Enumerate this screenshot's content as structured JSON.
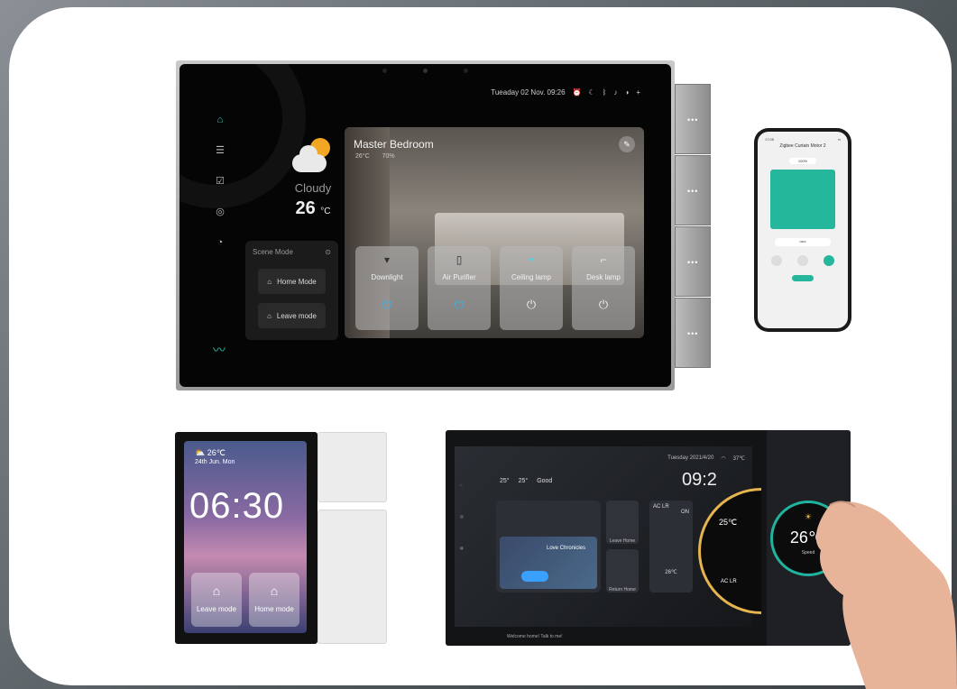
{
  "big_panel": {
    "datetime": "Tueaday 02 Nov. 09:26",
    "weather_condition": "Cloudy",
    "temperature": "26",
    "temperature_unit": "°C",
    "scene_mode": {
      "title": "Scene Mode",
      "buttons": [
        "Home Mode",
        "Leave mode"
      ]
    },
    "room": {
      "title": "Master Bedroom",
      "temp": "26°C",
      "humidity": "70%",
      "devices": [
        {
          "label": "Downlight",
          "on": true
        },
        {
          "label": "Air Purifier",
          "on": true
        },
        {
          "label": "Ceiling lamp",
          "on": false
        },
        {
          "label": "Desk lamp",
          "on": false
        }
      ]
    }
  },
  "phone": {
    "time": "17:05",
    "title": "Zigbee Curtain Motor 2",
    "top_percent": "100%",
    "bottom_percent": "100%"
  },
  "small_panel": {
    "temperature": "26℃",
    "date": "24th Jun. Mon",
    "time": "06:30",
    "buttons": [
      "Leave mode",
      "Home mode"
    ]
  },
  "wide_panel": {
    "date": "Tuesday 2021/4/20",
    "outdoor_temp": "37℃",
    "weather": [
      "25°",
      "25°",
      "Good"
    ],
    "clock": "09:2",
    "music_title": "Love Chronicles",
    "tiles": [
      "Leave Home",
      "Return Home"
    ],
    "ac_label": "AC LR",
    "ac_state": "ON",
    "ac_temp": "26℃",
    "ring_temp": "25℃",
    "ring_label": "AC LR",
    "voice_prompt": "Welcome home! Talk to me!",
    "knob_temp": "26℃",
    "knob_label": "Speed"
  },
  "colors": {
    "accent": "#2fc1a8",
    "sun": "#f3a623",
    "power_on": "#29b6f6",
    "ring": "#e7b54e"
  }
}
